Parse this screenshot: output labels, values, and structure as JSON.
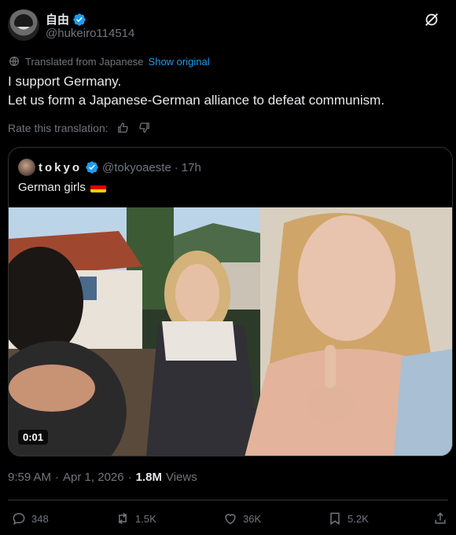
{
  "author": {
    "display_name": "自由",
    "handle": "@hukeiro114514"
  },
  "translation": {
    "label": "Translated from Japanese",
    "show_original": "Show original",
    "rate_label": "Rate this translation:"
  },
  "tweet": {
    "line1": "I support Germany.",
    "line2": "Let us form a Japanese-German alliance to defeat communism."
  },
  "quote": {
    "display_name": "tokyo",
    "handle": "@tokyoaeste",
    "separator": "·",
    "time": "17h",
    "text": "German girls",
    "video_duration": "0:01"
  },
  "meta": {
    "time": "9:59 AM",
    "separator": "·",
    "date": "Apr 1, 2026",
    "separator2": "·",
    "views_count": "1.8M",
    "views_label": "Views"
  },
  "actions": {
    "replies": "348",
    "reposts": "1.5K",
    "likes": "36K",
    "bookmarks": "5.2K"
  },
  "colors": {
    "background": "#000000",
    "accent": "#1d9bf0",
    "secondary_text": "#71767b",
    "border": "#2f3336"
  },
  "icons": [
    "verified-badge-icon",
    "grok-icon",
    "translate-icon",
    "thumbs-up-icon",
    "thumbs-down-icon",
    "reply-icon",
    "repost-icon",
    "like-icon",
    "bookmark-icon",
    "share-icon"
  ]
}
